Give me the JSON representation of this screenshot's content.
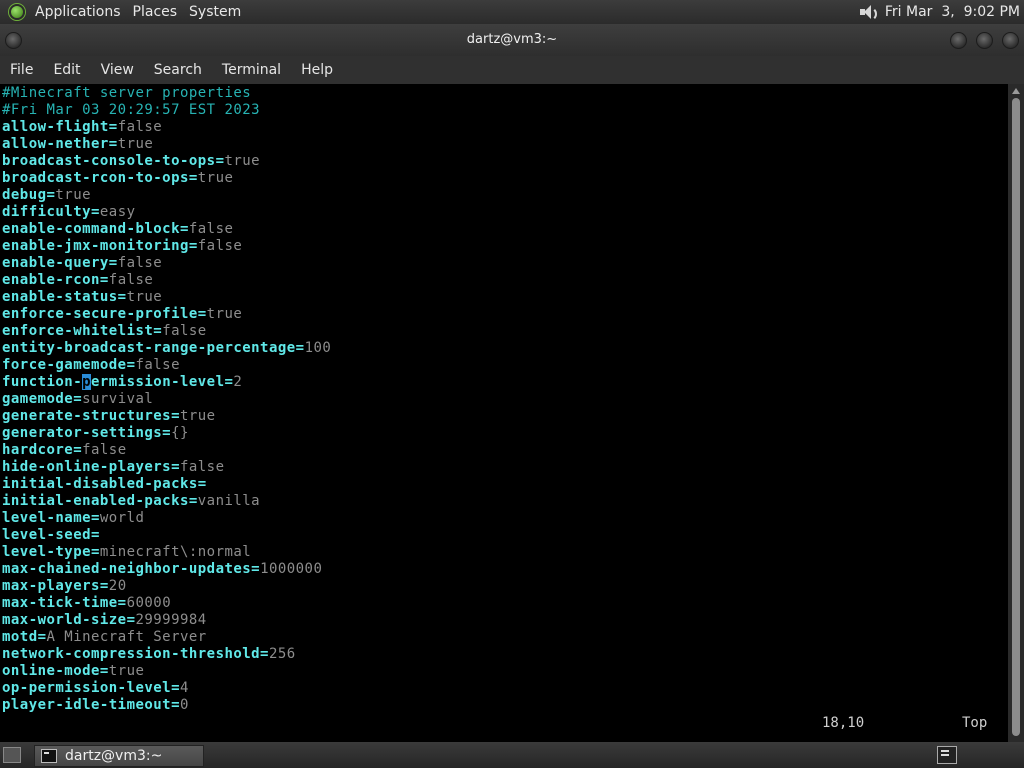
{
  "top_panel": {
    "menus": [
      "Applications",
      "Places",
      "System"
    ],
    "clock": "Fri Mar  3,  9:02 PM"
  },
  "window": {
    "title": "dartz@vm3:~"
  },
  "menubar": [
    "File",
    "Edit",
    "View",
    "Search",
    "Terminal",
    "Help"
  ],
  "editor": {
    "comments": [
      "#Minecraft server properties",
      "#Fri Mar 03 20:29:57 EST 2023"
    ],
    "properties": [
      {
        "key": "allow-flight",
        "value": "false"
      },
      {
        "key": "allow-nether",
        "value": "true"
      },
      {
        "key": "broadcast-console-to-ops",
        "value": "true"
      },
      {
        "key": "broadcast-rcon-to-ops",
        "value": "true"
      },
      {
        "key": "debug",
        "value": "true"
      },
      {
        "key": "difficulty",
        "value": "easy"
      },
      {
        "key": "enable-command-block",
        "value": "false"
      },
      {
        "key": "enable-jmx-monitoring",
        "value": "false"
      },
      {
        "key": "enable-query",
        "value": "false"
      },
      {
        "key": "enable-rcon",
        "value": "false"
      },
      {
        "key": "enable-status",
        "value": "true"
      },
      {
        "key": "enforce-secure-profile",
        "value": "true"
      },
      {
        "key": "enforce-whitelist",
        "value": "false"
      },
      {
        "key": "entity-broadcast-range-percentage",
        "value": "100"
      },
      {
        "key": "force-gamemode",
        "value": "false"
      },
      {
        "key": "function-permission-level",
        "value": "2"
      },
      {
        "key": "gamemode",
        "value": "survival"
      },
      {
        "key": "generate-structures",
        "value": "true"
      },
      {
        "key": "generator-settings",
        "value": "{}"
      },
      {
        "key": "hardcore",
        "value": "false"
      },
      {
        "key": "hide-online-players",
        "value": "false"
      },
      {
        "key": "initial-disabled-packs",
        "value": ""
      },
      {
        "key": "initial-enabled-packs",
        "value": "vanilla"
      },
      {
        "key": "level-name",
        "value": "world"
      },
      {
        "key": "level-seed",
        "value": ""
      },
      {
        "key": "level-type",
        "value": "minecraft\\:normal"
      },
      {
        "key": "max-chained-neighbor-updates",
        "value": "1000000"
      },
      {
        "key": "max-players",
        "value": "20"
      },
      {
        "key": "max-tick-time",
        "value": "60000"
      },
      {
        "key": "max-world-size",
        "value": "29999984"
      },
      {
        "key": "motd",
        "value": "A Minecraft Server"
      },
      {
        "key": "network-compression-threshold",
        "value": "256"
      },
      {
        "key": "online-mode",
        "value": "true"
      },
      {
        "key": "op-permission-level",
        "value": "4"
      },
      {
        "key": "player-idle-timeout",
        "value": "0"
      }
    ],
    "cursor": {
      "line": 18,
      "column": 10
    },
    "status_position": "18,10",
    "status_scroll": "Top"
  },
  "taskbar": {
    "task_label": "dartz@vm3:~"
  },
  "colors": {
    "key": "#60e8e8",
    "comment": "#27b3b3",
    "value": "#8d8d8d",
    "cursor": "#2a8cd8"
  },
  "icons": [
    "gnome-foot-icon",
    "speaker-icon",
    "close-icon",
    "minimize-icon",
    "maximize-icon",
    "show-desktop-icon",
    "terminal-icon"
  ]
}
